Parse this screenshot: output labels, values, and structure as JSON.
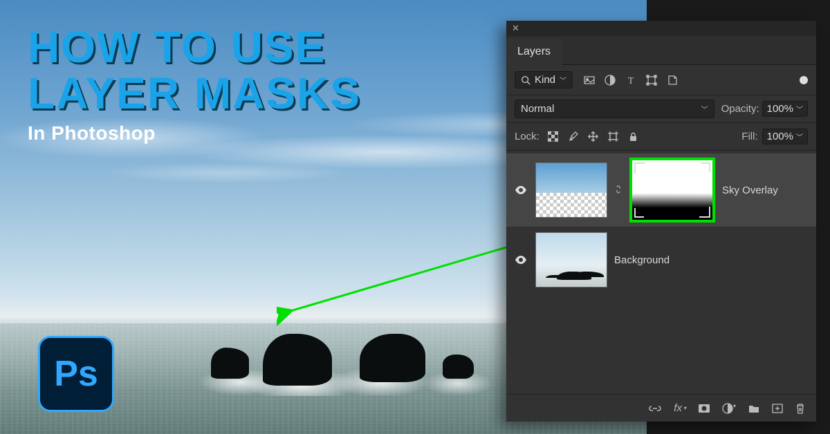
{
  "title": {
    "line1": "HOW TO USE",
    "line2": "LAYER MASKS",
    "subtitle": "In Photoshop"
  },
  "logo": {
    "text": "Ps"
  },
  "panel": {
    "tab": "Layers",
    "filter": {
      "label": "Kind"
    },
    "blend": {
      "mode": "Normal",
      "opacity_label": "Opacity:",
      "opacity_value": "100%"
    },
    "lock": {
      "label": "Lock:",
      "fill_label": "Fill:",
      "fill_value": "100%"
    },
    "layers": [
      {
        "name": "Sky Overlay"
      },
      {
        "name": "Background"
      }
    ],
    "footer_fx": "fx"
  }
}
